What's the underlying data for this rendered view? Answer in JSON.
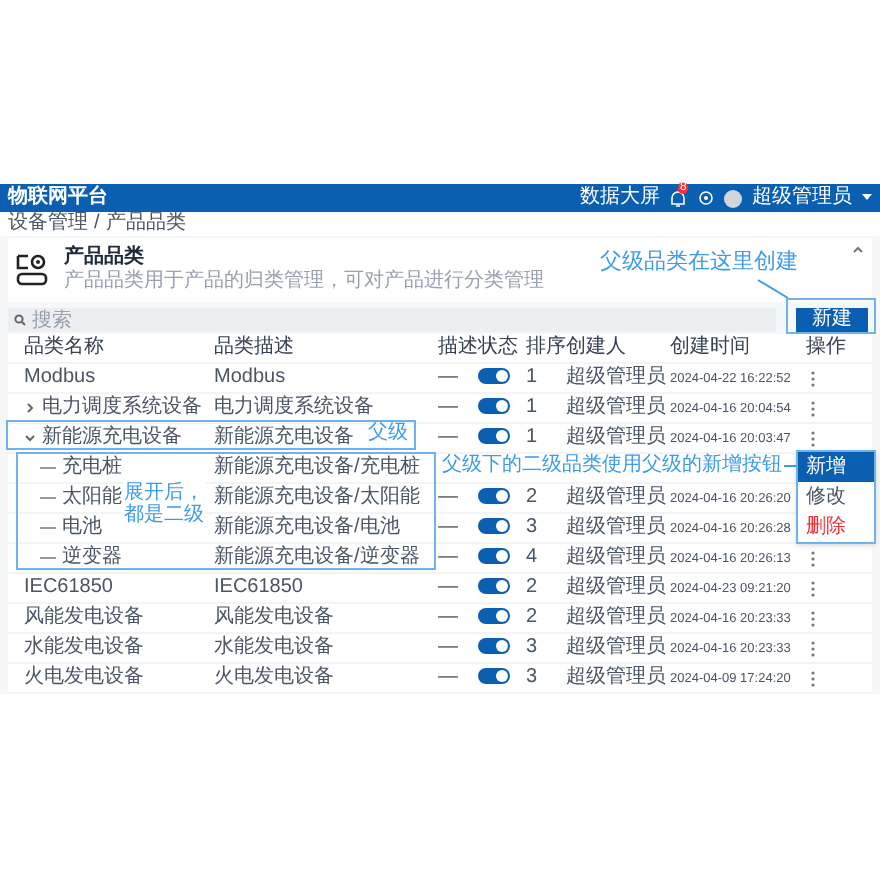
{
  "header": {
    "title": "物联网平台",
    "dashboard_link": "数据大屏",
    "notification_count": "8",
    "user": "超级管理员"
  },
  "breadcrumb": {
    "items": [
      "设备管理",
      "产品品类"
    ],
    "separator": "/"
  },
  "card": {
    "title": "产品品类",
    "description": "产品品类用于产品的归类管理，可对产品进行分类管理"
  },
  "search": {
    "placeholder": "搜索"
  },
  "new_button": "新建",
  "table": {
    "columns": [
      "品类名称",
      "品类描述",
      "描述",
      "状态",
      "排序",
      "创建人",
      "创建时间",
      "操作"
    ],
    "rows": [
      {
        "name": "Modbus",
        "description": "Modbus",
        "remark": "—",
        "enabled": true,
        "sort": "1",
        "creator": "超级管理员",
        "created_at": "2024-04-22 16:22:52"
      },
      {
        "name": "电力调度系统设备",
        "expanded": false,
        "description": "电力调度系统设备",
        "remark": "—",
        "enabled": true,
        "sort": "1",
        "creator": "超级管理员",
        "created_at": "2024-04-16 20:04:54"
      },
      {
        "name": "新能源充电设备",
        "expanded": true,
        "description": "新能源充电设备",
        "remark": "—",
        "enabled": true,
        "sort": "1",
        "creator": "超级管理员",
        "created_at": "2024-04-16 20:03:47",
        "children": [
          {
            "name": "充电桩",
            "description": "新能源充电设备/充电桩"
          },
          {
            "name": "太阳能",
            "description": "新能源充电设备/太阳能",
            "remark": "—",
            "enabled": true,
            "sort": "2",
            "creator": "超级管理员",
            "created_at": "2024-04-16 20:26:20"
          },
          {
            "name": "电池",
            "description": "新能源充电设备/电池",
            "remark": "—",
            "enabled": true,
            "sort": "3",
            "creator": "超级管理员",
            "created_at": "2024-04-16 20:26:28"
          },
          {
            "name": "逆变器",
            "description": "新能源充电设备/逆变器",
            "remark": "—",
            "enabled": true,
            "sort": "4",
            "creator": "超级管理员",
            "created_at": "2024-04-16 20:26:13"
          }
        ]
      },
      {
        "name": "IEC61850",
        "description": "IEC61850",
        "remark": "—",
        "enabled": true,
        "sort": "2",
        "creator": "超级管理员",
        "created_at": "2024-04-23 09:21:20"
      },
      {
        "name": "风能发电设备",
        "description": "风能发电设备",
        "remark": "—",
        "enabled": true,
        "sort": "2",
        "creator": "超级管理员",
        "created_at": "2024-04-16 20:23:33"
      },
      {
        "name": "水能发电设备",
        "description": "水能发电设备",
        "remark": "—",
        "enabled": true,
        "sort": "3",
        "creator": "超级管理员",
        "created_at": "2024-04-16 20:23:33"
      },
      {
        "name": "火电发电设备",
        "description": "火电发电设备",
        "remark": "—",
        "enabled": true,
        "sort": "3",
        "creator": "超级管理员",
        "created_at": "2024-04-09 17:24:20"
      }
    ]
  },
  "row_menu": {
    "items": [
      {
        "label": "新增",
        "selected": true,
        "kind": "normal"
      },
      {
        "label": "修改",
        "selected": false,
        "kind": "normal"
      },
      {
        "label": "删除",
        "selected": false,
        "kind": "danger"
      }
    ]
  },
  "annotations": [
    {
      "text": "父级品类在这里创建"
    },
    {
      "text": "父级"
    },
    {
      "text": "展开后，都是二级"
    },
    {
      "text": "父级下的二级品类使用父级的新增按钮"
    }
  ]
}
